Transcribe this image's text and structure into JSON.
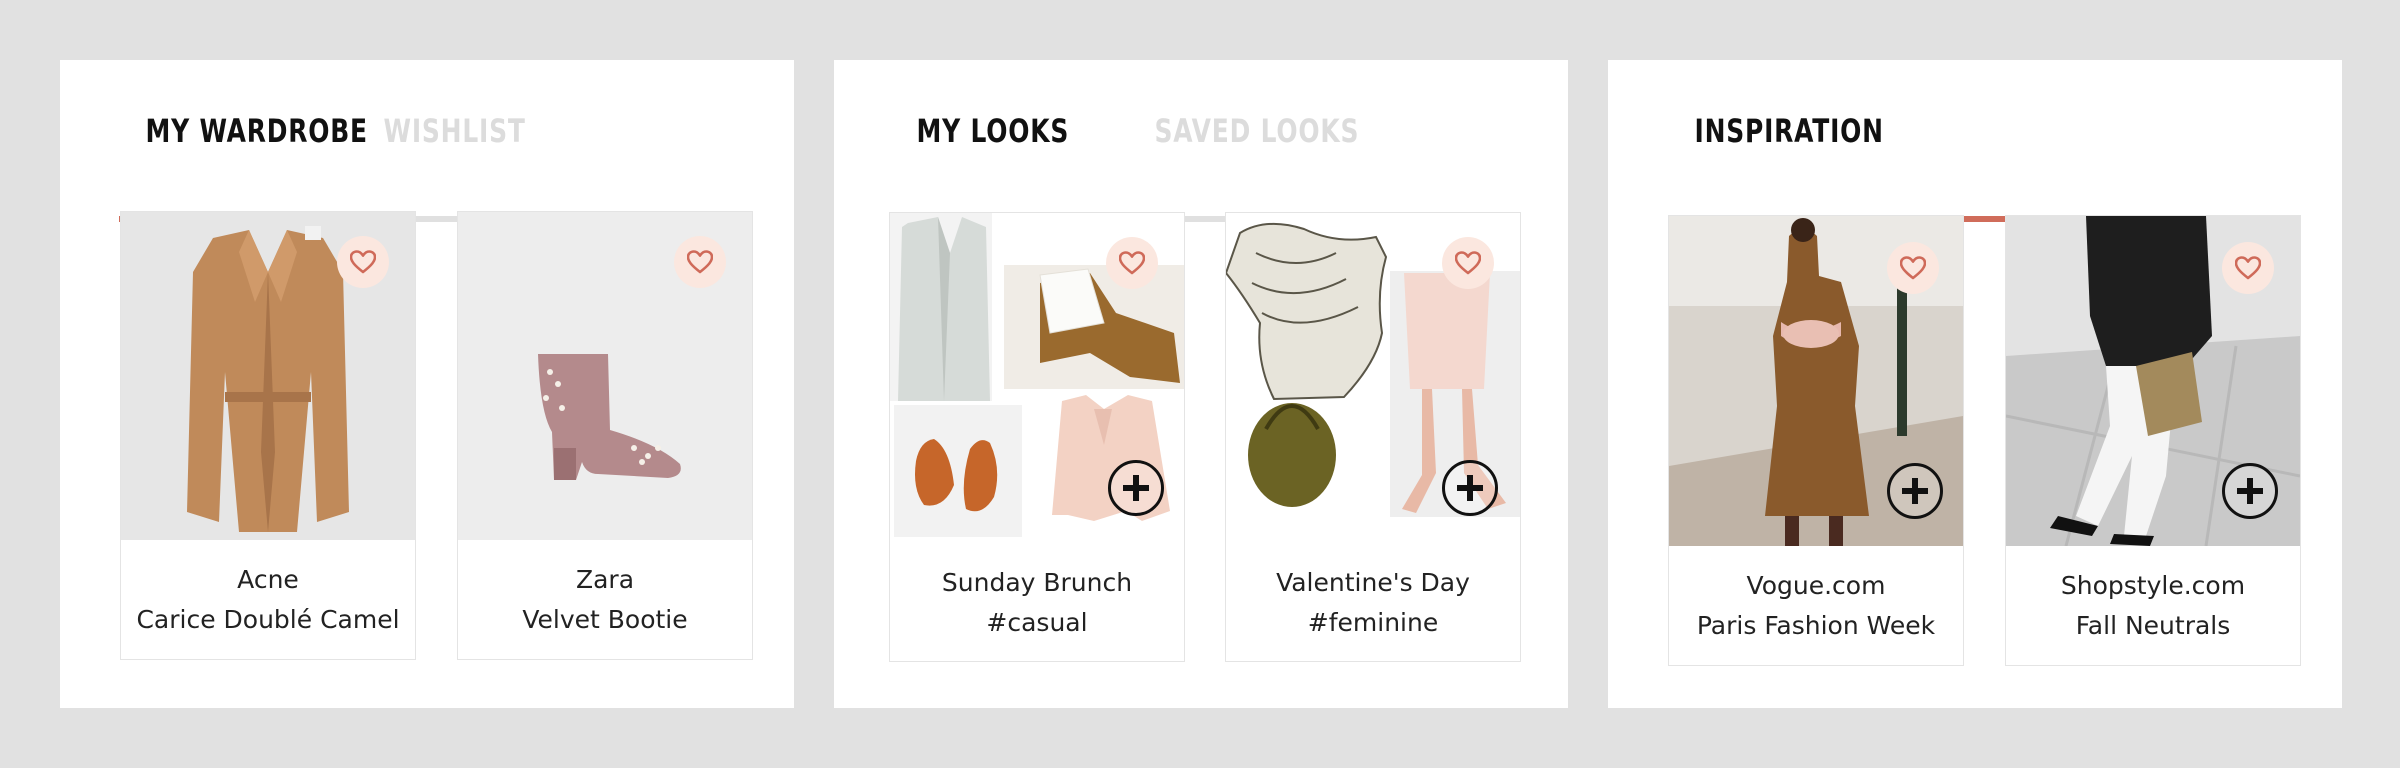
{
  "colors": {
    "background": "#e1e1e1",
    "panel": "#ffffff",
    "accent": "#d06c5a",
    "tab_track": "#e0e0e0",
    "favorite_bg": "#fbe7df"
  },
  "wardrobe": {
    "tabs": [
      {
        "label": "MY WARDROBE",
        "active": true
      },
      {
        "label": "WISHLIST",
        "active": false
      }
    ],
    "cards": [
      {
        "line1": "Acne",
        "line2": "Carice Doublé Camel",
        "image": "camel-coat"
      },
      {
        "line1": "Zara",
        "line2": "Velvet Bootie",
        "image": "pink-velvet-bootie"
      }
    ]
  },
  "looks": {
    "tabs": [
      {
        "label": "MY LOOKS",
        "active": true
      },
      {
        "label": "SAVED LOOKS",
        "active": false
      }
    ],
    "cards": [
      {
        "line1": "Sunday Brunch",
        "line2": "#casual",
        "image": "look-collage-casual"
      },
      {
        "line1": "Valentine's Day",
        "line2": "#feminine",
        "image": "look-collage-feminine"
      }
    ]
  },
  "inspiration": {
    "tabs": [
      {
        "label": "INSPIRATION",
        "active": true
      }
    ],
    "cards": [
      {
        "line1": "Vogue.com",
        "line2": "Paris Fashion Week",
        "image": "street-style-knit-dress"
      },
      {
        "line1": "Shopstyle.com",
        "line2": "Fall Neutrals",
        "image": "street-style-leather-jacket"
      }
    ]
  },
  "icons": {
    "favorite": "heart-icon",
    "add": "plus-circle-icon"
  }
}
